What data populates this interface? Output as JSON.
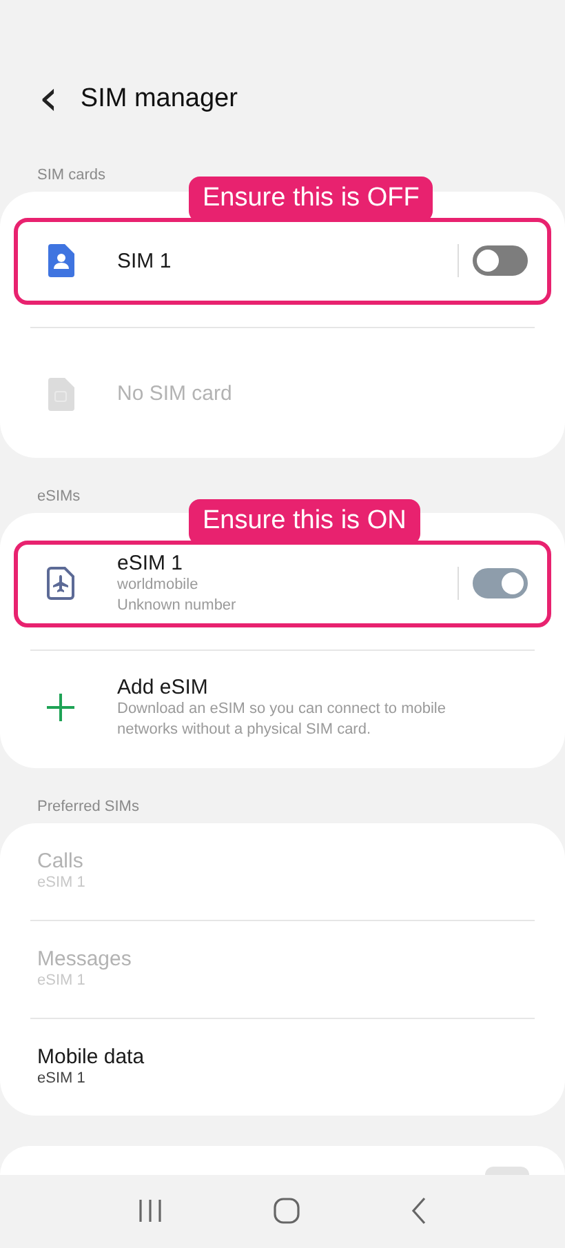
{
  "header": {
    "back": "‹",
    "title": "SIM manager"
  },
  "sections": [
    {
      "label": "SIM cards",
      "items": [
        {
          "kind": "sim",
          "title": "SIM 1",
          "on": false,
          "disabled": false,
          "callout": "Ensure this is OFF"
        },
        {
          "kind": "empty",
          "title": "No SIM card",
          "disabled": true
        }
      ]
    },
    {
      "label": "eSIMs",
      "items": [
        {
          "kind": "esim",
          "title": "eSIM 1",
          "lines": [
            "worldmobile",
            "Unknown number"
          ],
          "on": true,
          "disabled": false,
          "callout": "Ensure this is ON"
        },
        {
          "kind": "add",
          "title": "Add eSIM",
          "lines": [
            "Download an eSIM so you can connect to mobile networks without a physical SIM card."
          ],
          "disabled": false
        }
      ]
    },
    {
      "label": "Preferred SIMs",
      "items": [
        {
          "kind": "pref",
          "title": "Calls",
          "lines": [
            "eSIM 1"
          ],
          "disabled": true
        },
        {
          "kind": "pref",
          "title": "Messages",
          "lines": [
            "eSIM 1"
          ],
          "disabled": true
        },
        {
          "kind": "pref",
          "title": "Mobile data",
          "lines": [
            "eSIM 1"
          ],
          "disabled": false
        }
      ]
    }
  ]
}
